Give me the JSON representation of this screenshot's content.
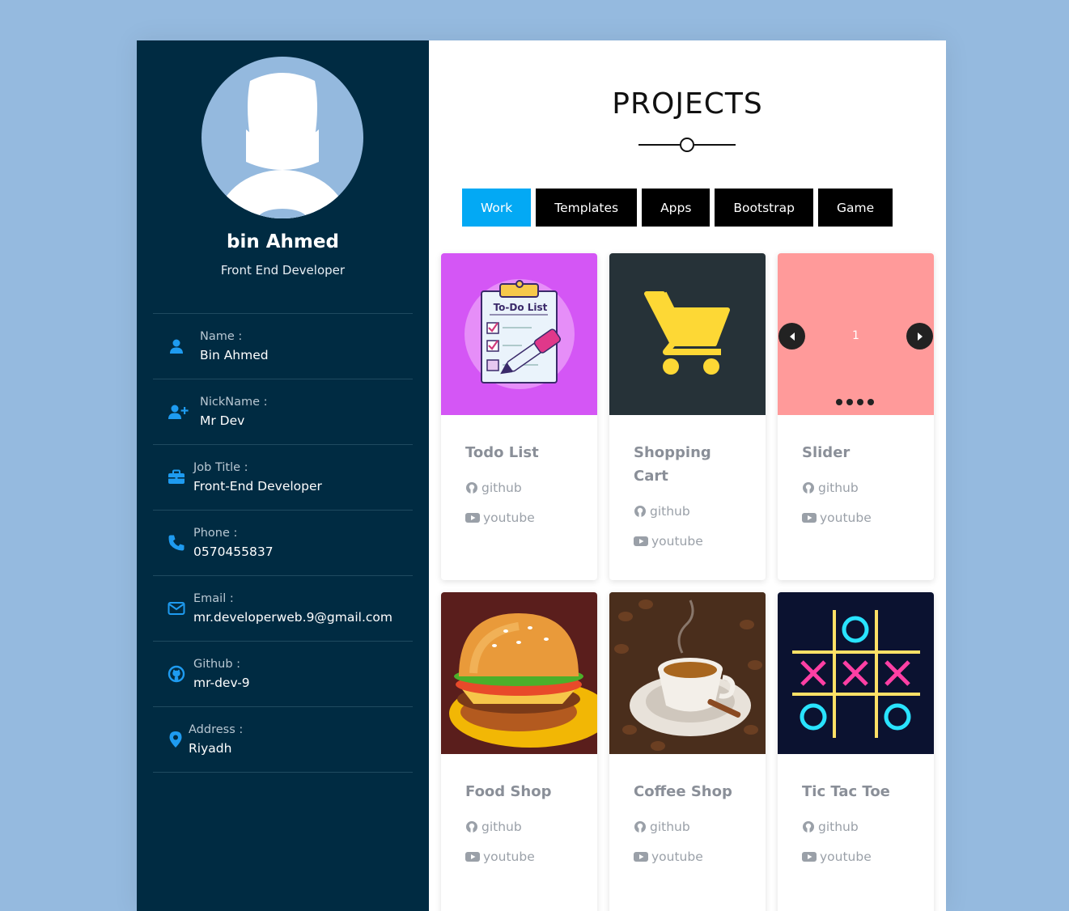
{
  "profile": {
    "name": "bin Ahmed",
    "role": "Front End Developer"
  },
  "info": [
    {
      "icon": "user-icon",
      "label": "Name :",
      "value": "Bin Ahmed"
    },
    {
      "icon": "user-plus-icon",
      "label": "NickName :",
      "value": "Mr Dev"
    },
    {
      "icon": "briefcase-icon",
      "label": "Job Title :",
      "value": "Front-End Developer"
    },
    {
      "icon": "phone-icon",
      "label": "Phone :",
      "value": "0570455837"
    },
    {
      "icon": "envelope-icon",
      "label": "Email :",
      "value": "mr.developerweb.9@gmail.com"
    },
    {
      "icon": "github-icon",
      "label": "Github :",
      "value": "mr-dev-9"
    },
    {
      "icon": "map-pin-icon",
      "label": "Address :",
      "value": "Riyadh"
    }
  ],
  "main": {
    "title": "PROJECTS",
    "tabs": [
      {
        "label": "Work",
        "active": true
      },
      {
        "label": "Templates",
        "active": false
      },
      {
        "label": "Apps",
        "active": false
      },
      {
        "label": "Bootstrap",
        "active": false
      },
      {
        "label": "Game",
        "active": false
      }
    ],
    "slider_number": "1",
    "projects": [
      {
        "title": "Todo List",
        "thumb_text": "To-Do List",
        "github": "github",
        "youtube": "youtube"
      },
      {
        "title": "Shopping Cart",
        "github": "github",
        "youtube": "youtube"
      },
      {
        "title": "Slider",
        "github": "github",
        "youtube": "youtube"
      },
      {
        "title": "Food Shop",
        "github": "github",
        "youtube": "youtube"
      },
      {
        "title": "Coffee Shop",
        "github": "github",
        "youtube": "youtube"
      },
      {
        "title": "Tic Tac Toe",
        "github": "github",
        "youtube": "youtube"
      }
    ]
  },
  "colors": {
    "page_bg": "#95badf",
    "sidebar_bg": "#002b42",
    "accent": "#03a9f4",
    "icon_blue": "#1e9bf0"
  }
}
